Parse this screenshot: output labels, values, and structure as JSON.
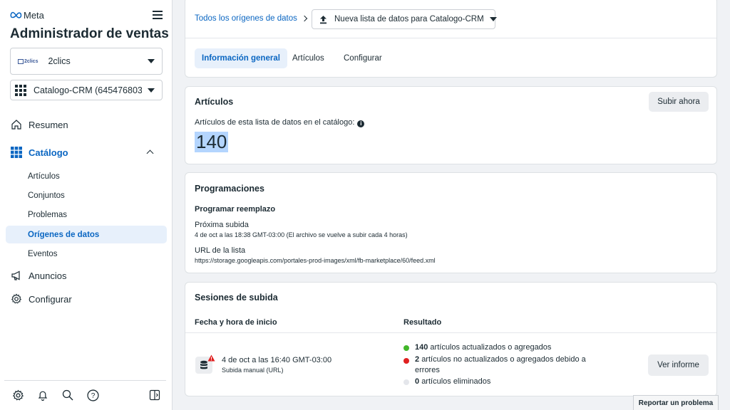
{
  "sidebar": {
    "brand": "Meta",
    "app_title": "Administrador de ventas",
    "business_selector": {
      "logo_text": "2clics",
      "label": "2clics"
    },
    "catalog_selector": {
      "label": "Catalogo-CRM (645476803..."
    },
    "nav": {
      "resumen": "Resumen",
      "catalogo": "Catálogo",
      "sub_items": [
        "Artículos",
        "Conjuntos",
        "Problemas",
        "Orígenes de datos",
        "Eventos"
      ],
      "anuncios": "Anuncios",
      "configurar": "Configurar"
    }
  },
  "breadcrumb": {
    "link": "Todos los orígenes de datos",
    "current": "Nueva lista de datos para Catalogo-CRM"
  },
  "tabs": [
    "Información general",
    "Artículos",
    "Configurar"
  ],
  "items_card": {
    "title": "Artículos",
    "upload_button": "Subir ahora",
    "description": "Artículos de esta lista de datos en el catálogo:",
    "count": "140"
  },
  "schedules": {
    "title": "Programaciones",
    "subtitle": "Programar reemplazo",
    "next_label": "Próxima subida",
    "next_value": "4 de oct a las 18:38 GMT-03:00 (El archivo se vuelve a subir cada 4 horas)",
    "url_label": "URL de la lista",
    "url_value": "https://storage.googleapis.com/portales-prod-images/xml/fb-marketplace/60/feed.xml"
  },
  "sessions": {
    "title": "Sesiones de subida",
    "col_start": "Fecha y hora de inicio",
    "col_result": "Resultado",
    "row": {
      "datetime": "4 de oct a las 16:40 GMT-03:00",
      "type": "Subida manual (URL)",
      "results": [
        {
          "count": "140",
          "text": "artículos actualizados o agregados",
          "color": "#42b72a"
        },
        {
          "count": "2",
          "text": "artículos no actualizados o agregados debido a errores",
          "color": "#e02020"
        },
        {
          "count": "0",
          "text": "artículos eliminados",
          "color": "#e4e6eb"
        }
      ],
      "report_button": "Ver informe"
    }
  },
  "report_problem": "Reportar un problema",
  "colors": {
    "accent": "#0a66c2",
    "selected_bg": "#e7f0fb",
    "page_bg": "#f0f2f5"
  }
}
